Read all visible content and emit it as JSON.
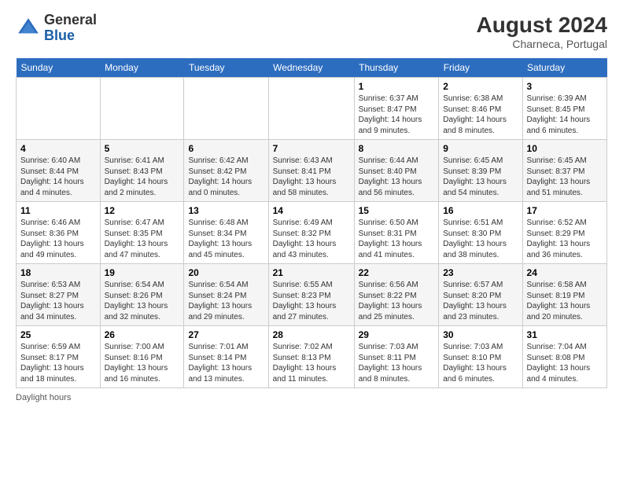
{
  "header": {
    "logo_general": "General",
    "logo_blue": "Blue",
    "month_year": "August 2024",
    "location": "Charneca, Portugal"
  },
  "footer": {
    "daylight_label": "Daylight hours"
  },
  "days_of_week": [
    "Sunday",
    "Monday",
    "Tuesday",
    "Wednesday",
    "Thursday",
    "Friday",
    "Saturday"
  ],
  "weeks": [
    [
      {
        "day": "",
        "info": ""
      },
      {
        "day": "",
        "info": ""
      },
      {
        "day": "",
        "info": ""
      },
      {
        "day": "",
        "info": ""
      },
      {
        "day": "1",
        "info": "Sunrise: 6:37 AM\nSunset: 8:47 PM\nDaylight: 14 hours\nand 9 minutes."
      },
      {
        "day": "2",
        "info": "Sunrise: 6:38 AM\nSunset: 8:46 PM\nDaylight: 14 hours\nand 8 minutes."
      },
      {
        "day": "3",
        "info": "Sunrise: 6:39 AM\nSunset: 8:45 PM\nDaylight: 14 hours\nand 6 minutes."
      }
    ],
    [
      {
        "day": "4",
        "info": "Sunrise: 6:40 AM\nSunset: 8:44 PM\nDaylight: 14 hours\nand 4 minutes."
      },
      {
        "day": "5",
        "info": "Sunrise: 6:41 AM\nSunset: 8:43 PM\nDaylight: 14 hours\nand 2 minutes."
      },
      {
        "day": "6",
        "info": "Sunrise: 6:42 AM\nSunset: 8:42 PM\nDaylight: 14 hours\nand 0 minutes."
      },
      {
        "day": "7",
        "info": "Sunrise: 6:43 AM\nSunset: 8:41 PM\nDaylight: 13 hours\nand 58 minutes."
      },
      {
        "day": "8",
        "info": "Sunrise: 6:44 AM\nSunset: 8:40 PM\nDaylight: 13 hours\nand 56 minutes."
      },
      {
        "day": "9",
        "info": "Sunrise: 6:45 AM\nSunset: 8:39 PM\nDaylight: 13 hours\nand 54 minutes."
      },
      {
        "day": "10",
        "info": "Sunrise: 6:45 AM\nSunset: 8:37 PM\nDaylight: 13 hours\nand 51 minutes."
      }
    ],
    [
      {
        "day": "11",
        "info": "Sunrise: 6:46 AM\nSunset: 8:36 PM\nDaylight: 13 hours\nand 49 minutes."
      },
      {
        "day": "12",
        "info": "Sunrise: 6:47 AM\nSunset: 8:35 PM\nDaylight: 13 hours\nand 47 minutes."
      },
      {
        "day": "13",
        "info": "Sunrise: 6:48 AM\nSunset: 8:34 PM\nDaylight: 13 hours\nand 45 minutes."
      },
      {
        "day": "14",
        "info": "Sunrise: 6:49 AM\nSunset: 8:32 PM\nDaylight: 13 hours\nand 43 minutes."
      },
      {
        "day": "15",
        "info": "Sunrise: 6:50 AM\nSunset: 8:31 PM\nDaylight: 13 hours\nand 41 minutes."
      },
      {
        "day": "16",
        "info": "Sunrise: 6:51 AM\nSunset: 8:30 PM\nDaylight: 13 hours\nand 38 minutes."
      },
      {
        "day": "17",
        "info": "Sunrise: 6:52 AM\nSunset: 8:29 PM\nDaylight: 13 hours\nand 36 minutes."
      }
    ],
    [
      {
        "day": "18",
        "info": "Sunrise: 6:53 AM\nSunset: 8:27 PM\nDaylight: 13 hours\nand 34 minutes."
      },
      {
        "day": "19",
        "info": "Sunrise: 6:54 AM\nSunset: 8:26 PM\nDaylight: 13 hours\nand 32 minutes."
      },
      {
        "day": "20",
        "info": "Sunrise: 6:54 AM\nSunset: 8:24 PM\nDaylight: 13 hours\nand 29 minutes."
      },
      {
        "day": "21",
        "info": "Sunrise: 6:55 AM\nSunset: 8:23 PM\nDaylight: 13 hours\nand 27 minutes."
      },
      {
        "day": "22",
        "info": "Sunrise: 6:56 AM\nSunset: 8:22 PM\nDaylight: 13 hours\nand 25 minutes."
      },
      {
        "day": "23",
        "info": "Sunrise: 6:57 AM\nSunset: 8:20 PM\nDaylight: 13 hours\nand 23 minutes."
      },
      {
        "day": "24",
        "info": "Sunrise: 6:58 AM\nSunset: 8:19 PM\nDaylight: 13 hours\nand 20 minutes."
      }
    ],
    [
      {
        "day": "25",
        "info": "Sunrise: 6:59 AM\nSunset: 8:17 PM\nDaylight: 13 hours\nand 18 minutes."
      },
      {
        "day": "26",
        "info": "Sunrise: 7:00 AM\nSunset: 8:16 PM\nDaylight: 13 hours\nand 16 minutes."
      },
      {
        "day": "27",
        "info": "Sunrise: 7:01 AM\nSunset: 8:14 PM\nDaylight: 13 hours\nand 13 minutes."
      },
      {
        "day": "28",
        "info": "Sunrise: 7:02 AM\nSunset: 8:13 PM\nDaylight: 13 hours\nand 11 minutes."
      },
      {
        "day": "29",
        "info": "Sunrise: 7:03 AM\nSunset: 8:11 PM\nDaylight: 13 hours\nand 8 minutes."
      },
      {
        "day": "30",
        "info": "Sunrise: 7:03 AM\nSunset: 8:10 PM\nDaylight: 13 hours\nand 6 minutes."
      },
      {
        "day": "31",
        "info": "Sunrise: 7:04 AM\nSunset: 8:08 PM\nDaylight: 13 hours\nand 4 minutes."
      }
    ]
  ]
}
